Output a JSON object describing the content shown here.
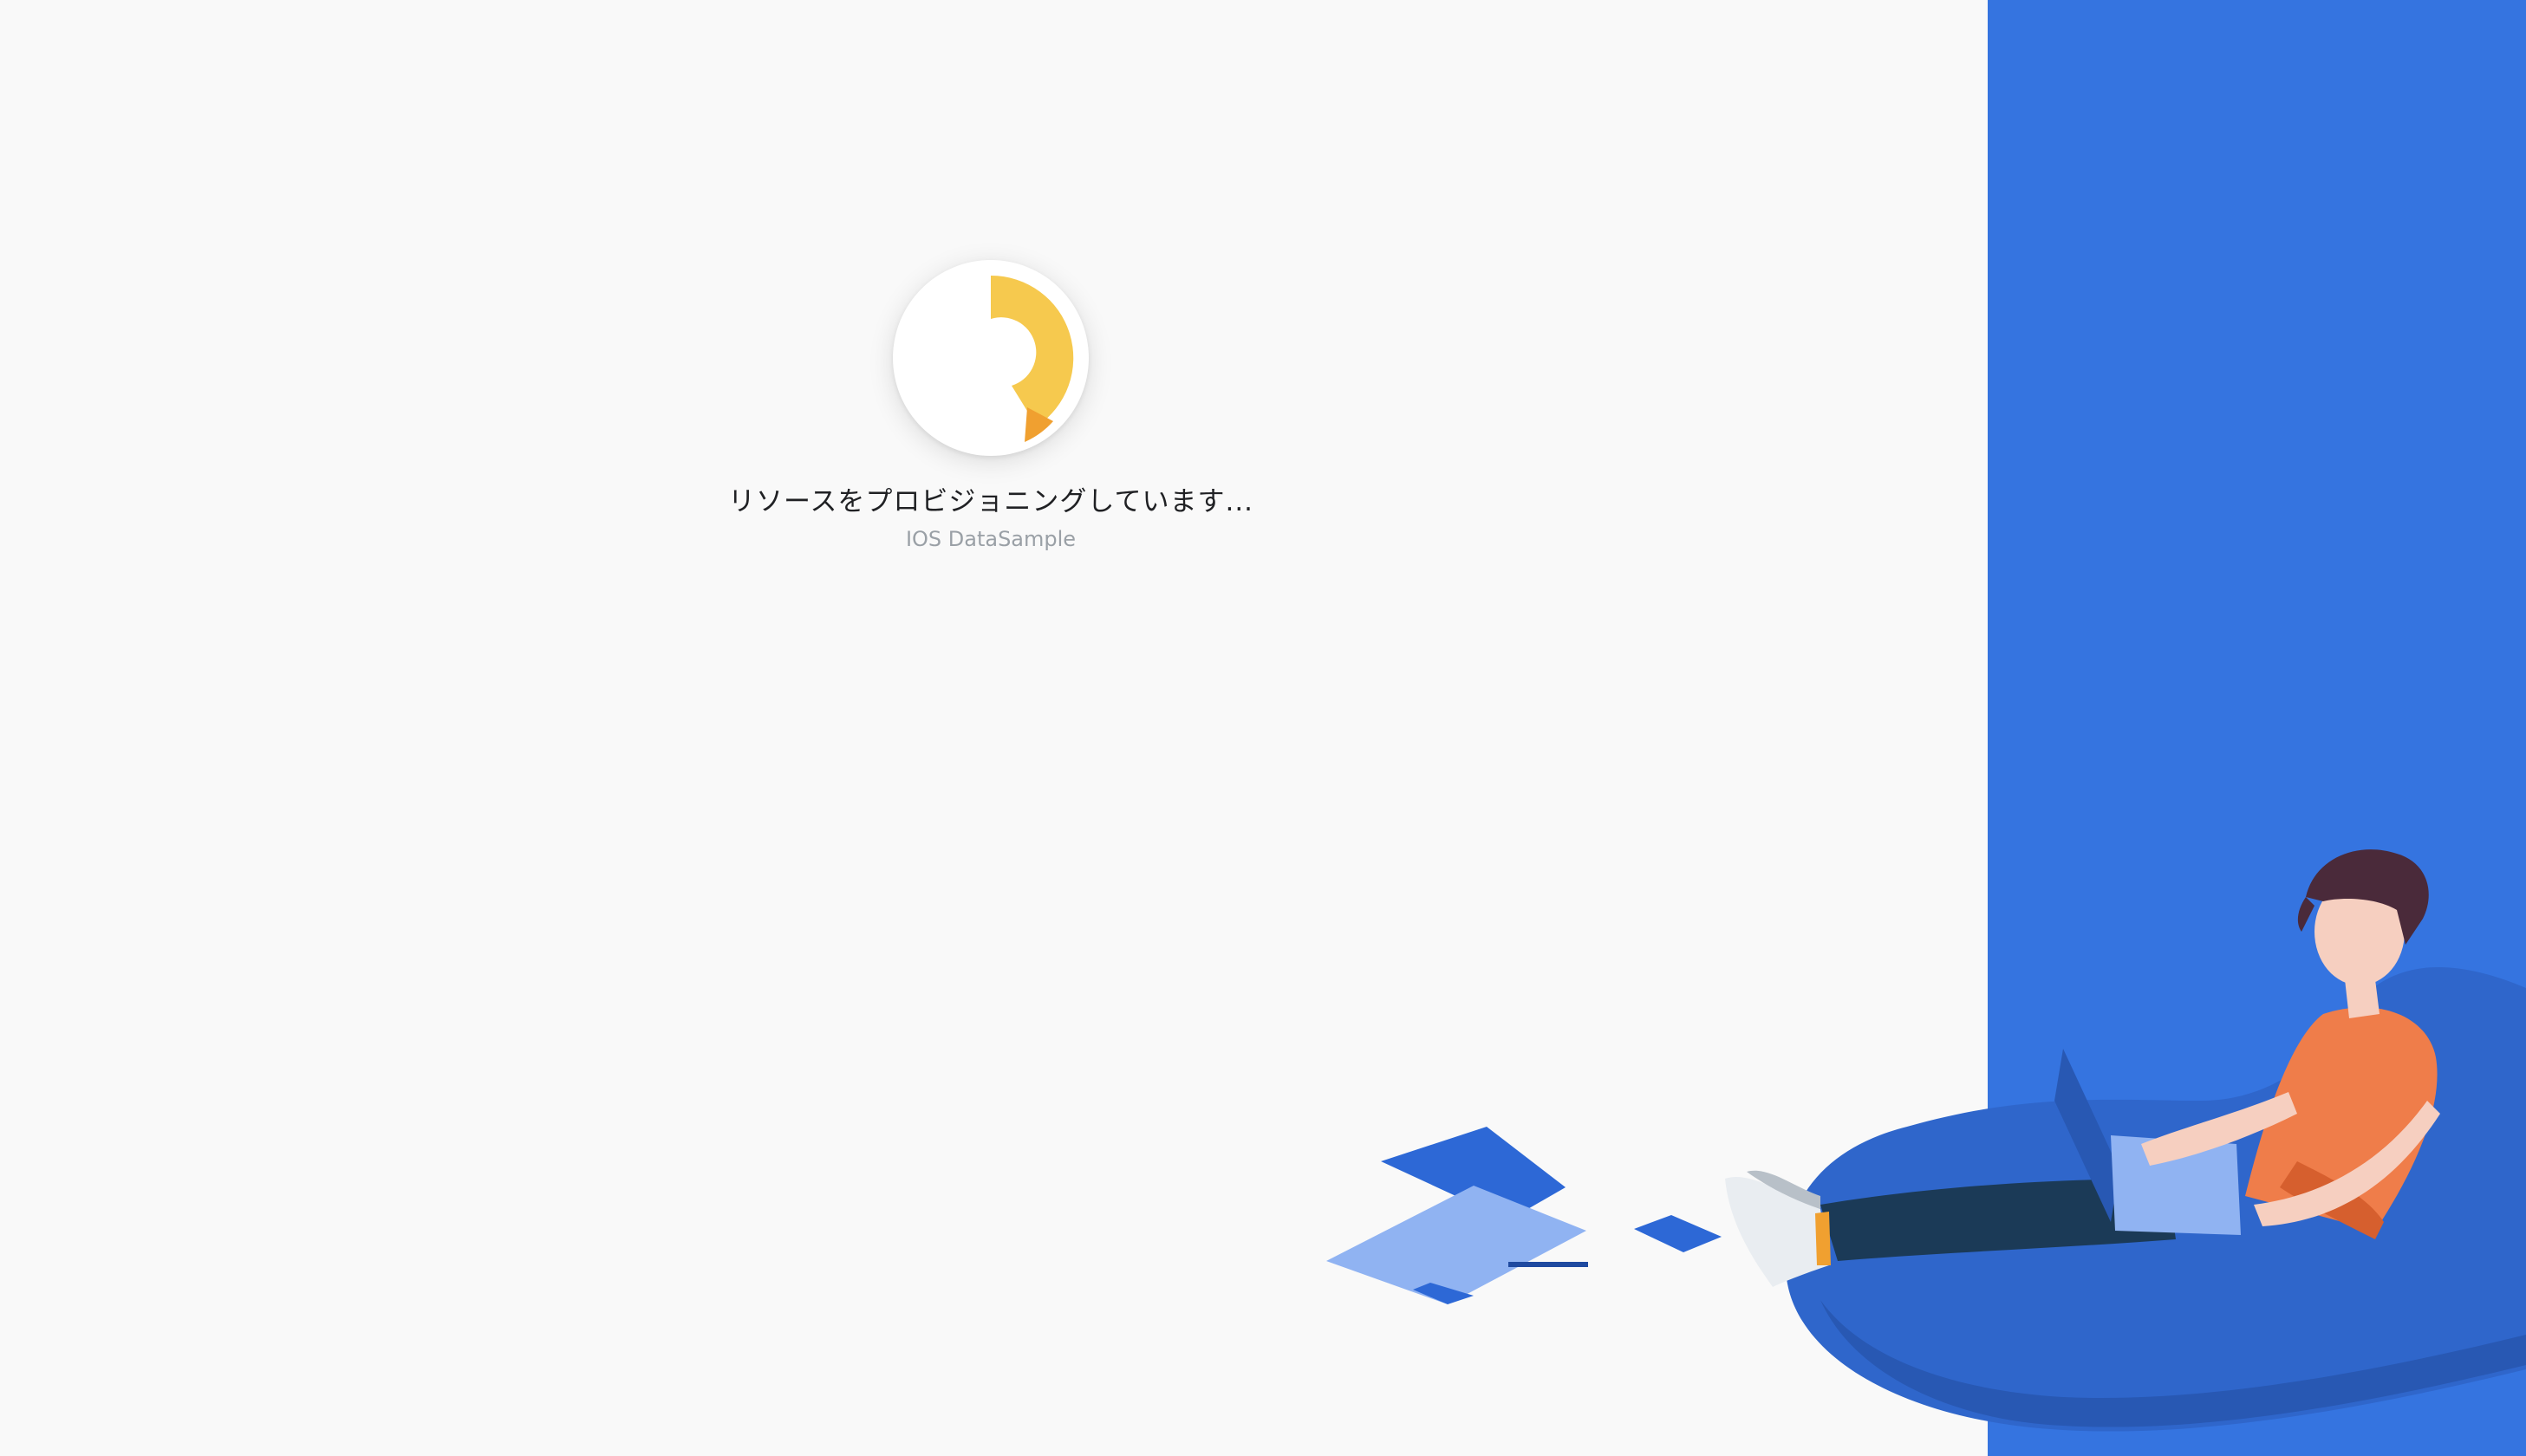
{
  "loading": {
    "status_text": "リソースをプロビジョニングしています...",
    "project_name": "IOS DataSample",
    "progress_fraction": 0.3
  },
  "colors": {
    "page_background": "#f9f9f9",
    "side_panel": "#3574e0",
    "spinner_primary": "#f6c94e",
    "spinner_secondary": "#f0a030"
  },
  "icons": {
    "spinner": "progress-spinner-icon",
    "illustration": "person-with-laptop-illustration"
  }
}
